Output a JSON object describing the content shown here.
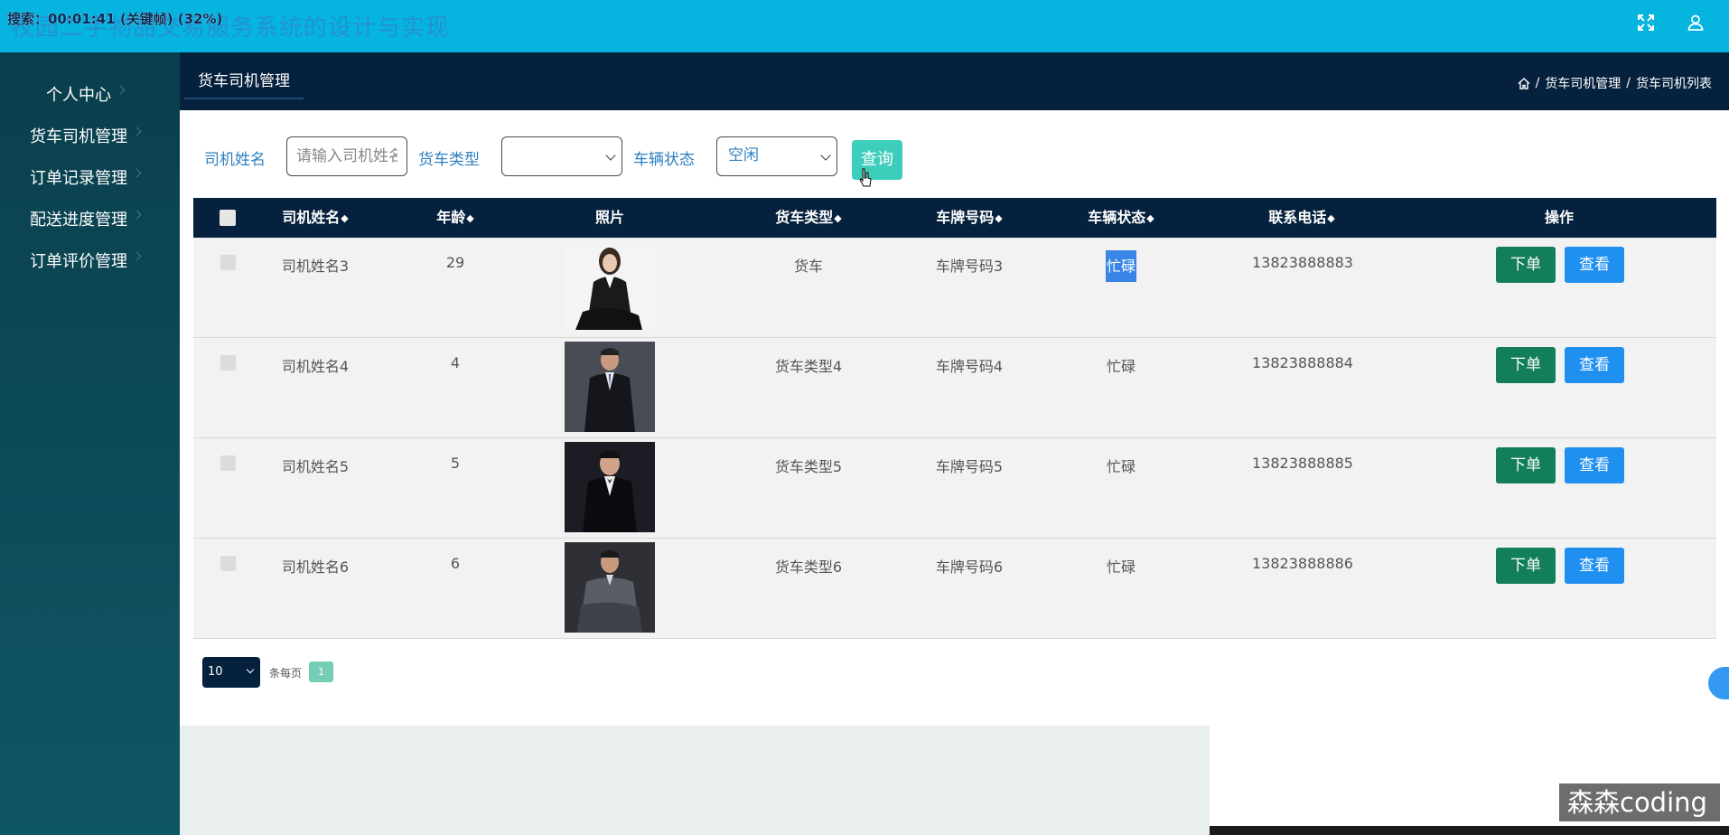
{
  "app_title": "校园二手物品交易服务系统的设计与实现",
  "overlay_text": "搜索：00:01:41 (关键帧) (32%)",
  "header_icons": {
    "fullscreen": "fullscreen-icon",
    "user": "user-icon"
  },
  "sidebar": {
    "items": [
      {
        "label": "个人中心"
      },
      {
        "label": "货车司机管理"
      },
      {
        "label": "订单记录管理"
      },
      {
        "label": "配送进度管理"
      },
      {
        "label": "订单评价管理"
      }
    ]
  },
  "tab": {
    "label": "货车司机管理"
  },
  "breadcrumb": {
    "items": [
      "货车司机管理",
      "货车司机列表"
    ]
  },
  "search": {
    "driver_name_label": "司机姓名",
    "driver_name_placeholder": "请输入司机姓名",
    "truck_type_label": "货车类型",
    "truck_type_value": "",
    "vehicle_status_label": "车辆状态",
    "vehicle_status_value": "空闲",
    "query_label": "查询"
  },
  "table": {
    "headers": {
      "name": "司机姓名",
      "age": "年龄",
      "photo": "照片",
      "truck_type": "货车类型",
      "plate": "车牌号码",
      "status": "车辆状态",
      "phone": "联系电话",
      "actions": "操作"
    },
    "rows": [
      {
        "name": "司机姓名3",
        "age": "29",
        "truck_type": "货车",
        "plate": "车牌号码3",
        "status": "忙碌",
        "phone": "13823888883",
        "order": "下单",
        "view": "查看"
      },
      {
        "name": "司机姓名4",
        "age": "4",
        "truck_type": "货车类型4",
        "plate": "车牌号码4",
        "status": "忙碌",
        "phone": "13823888884",
        "order": "下单",
        "view": "查看"
      },
      {
        "name": "司机姓名5",
        "age": "5",
        "truck_type": "货车类型5",
        "plate": "车牌号码5",
        "status": "忙碌",
        "phone": "13823888885",
        "order": "下单",
        "view": "查看"
      },
      {
        "name": "司机姓名6",
        "age": "6",
        "truck_type": "货车类型6",
        "plate": "车牌号码6",
        "status": "忙碌",
        "phone": "13823888886",
        "order": "下单",
        "view": "查看"
      }
    ]
  },
  "pagination": {
    "page_size": "10",
    "per_page_label": "条每页",
    "current_page": "1"
  },
  "watermark": "森森coding"
}
